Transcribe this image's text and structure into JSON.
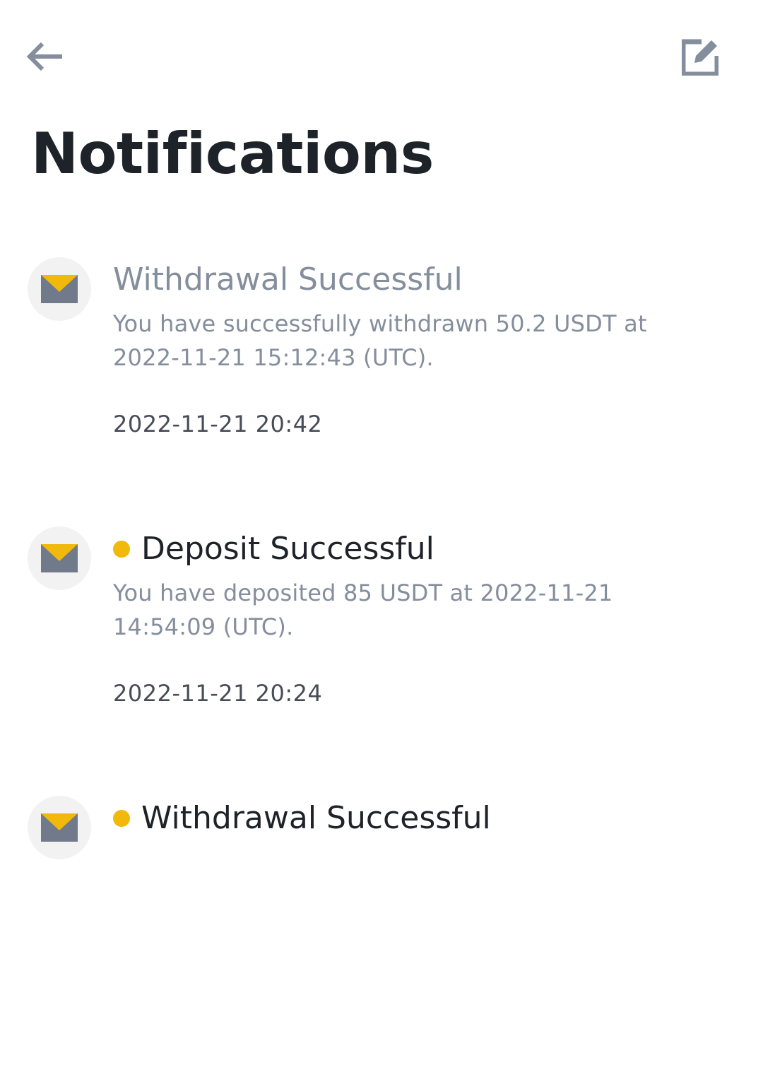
{
  "header": {
    "back_icon": "arrow-left-icon",
    "edit_icon": "edit-square-icon",
    "title": "Notifications"
  },
  "colors": {
    "accent": "#f0b90b",
    "title_text": "#1e2329",
    "secondary_text": "#848e9c",
    "time_text": "#474d57",
    "avatar_bg": "#f2f2f2"
  },
  "notifications": [
    {
      "icon": "envelope-icon",
      "unread": false,
      "title": "Withdrawal Successful",
      "body": "You have successfully withdrawn 50.2 USDT at 2022-11-21 15:12:43 (UTC).",
      "time": "2022-11-21 20:42"
    },
    {
      "icon": "envelope-icon",
      "unread": true,
      "title": "Deposit Successful",
      "body": "You have deposited 85 USDT at 2022-11-21 14:54:09 (UTC).",
      "time": "2022-11-21 20:24"
    },
    {
      "icon": "envelope-icon",
      "unread": true,
      "title": "Withdrawal Successful",
      "body": "",
      "time": ""
    }
  ]
}
